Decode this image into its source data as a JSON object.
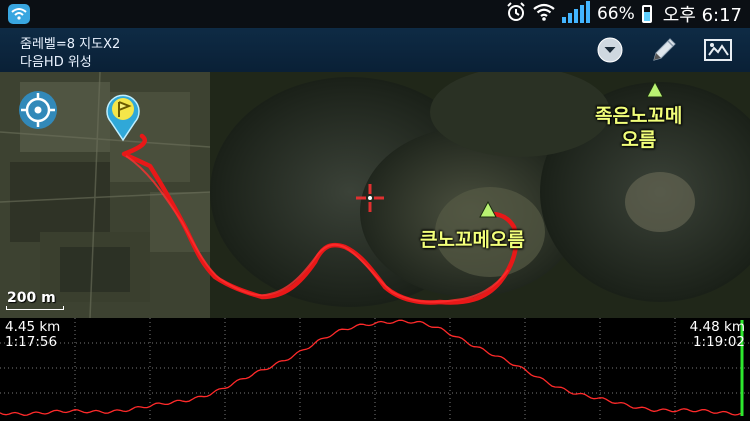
{
  "status_bar": {
    "battery_percent": "66%",
    "battery_level": 0.66,
    "time": "오후 6:17",
    "icons": [
      "app-icon",
      "alarm-icon",
      "wifi-icon",
      "signal-icon",
      "battery-icon"
    ]
  },
  "action_bar": {
    "line1": "줌레벨=8 지도X2",
    "line2": "다음HD 위성",
    "icons": [
      "dropdown-icon",
      "edit-pencil-icon",
      "map-layer-icon"
    ]
  },
  "map": {
    "labels": {
      "peak_small_line1": "족은노꼬메",
      "peak_small_line2": "오름",
      "peak_big": "큰노꼬메오름"
    },
    "scale_label": "200 m",
    "track_color": "#e81818",
    "label_color": "#f2ff7a"
  },
  "profile": {
    "left_distance": "4.45 km",
    "left_time": "1:17:56",
    "right_distance": "4.48 km",
    "right_time": "1:19:02",
    "line_color": "#ff2a2a",
    "cursor_color": "#2ee82e"
  }
}
